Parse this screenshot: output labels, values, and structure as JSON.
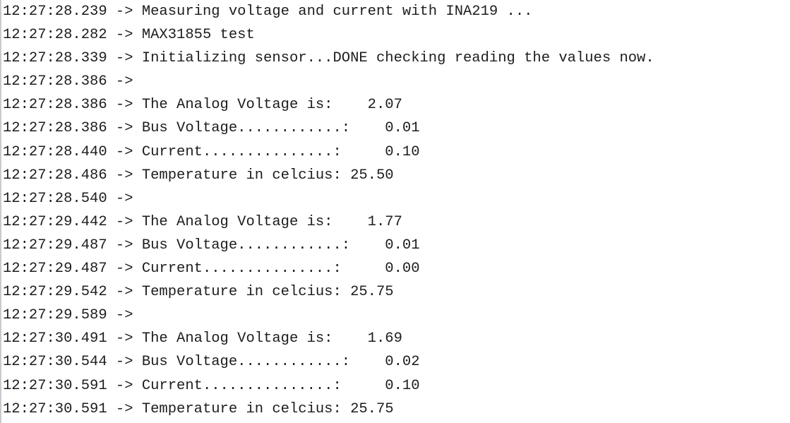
{
  "app": {
    "name": "serial-monitor",
    "background_color": "#ffffff",
    "text_color": "#1d1d1f",
    "border_color": "#c9c9cf"
  },
  "log": {
    "arrow": "->",
    "line_count": 18,
    "lines": [
      {
        "timestamp": "12:27:28.239",
        "arrow": "->",
        "message": "Measuring voltage and current with INA219 ...",
        "text": "12:27:28.239 -> Measuring voltage and current with INA219 ..."
      },
      {
        "timestamp": "12:27:28.282",
        "arrow": "->",
        "message": "MAX31855 test",
        "text": "12:27:28.282 -> MAX31855 test"
      },
      {
        "timestamp": "12:27:28.339",
        "arrow": "->",
        "message": "Initializing sensor...DONE checking reading the values now.",
        "text": "12:27:28.339 -> Initializing sensor...DONE checking reading the values now."
      },
      {
        "timestamp": "12:27:28.386",
        "arrow": "->",
        "message": "",
        "text": "12:27:28.386 ->"
      },
      {
        "timestamp": "12:27:28.386",
        "arrow": "->",
        "label": "The Analog Voltage is:",
        "value": "2.07",
        "text": "12:27:28.386 -> The Analog Voltage is:    2.07"
      },
      {
        "timestamp": "12:27:28.386",
        "arrow": "->",
        "label": "Bus Voltage............:",
        "value": "0.01",
        "text": "12:27:28.386 -> Bus Voltage............:    0.01"
      },
      {
        "timestamp": "12:27:28.440",
        "arrow": "->",
        "label": "Current...............:",
        "value": "0.10",
        "text": "12:27:28.440 -> Current...............:     0.10"
      },
      {
        "timestamp": "12:27:28.486",
        "arrow": "->",
        "label": "Temperature in celcius:",
        "value": "25.50",
        "text": "12:27:28.486 -> Temperature in celcius: 25.50"
      },
      {
        "timestamp": "12:27:28.540",
        "arrow": "->",
        "message": "",
        "text": "12:27:28.540 ->"
      },
      {
        "timestamp": "12:27:29.442",
        "arrow": "->",
        "label": "The Analog Voltage is:",
        "value": "1.77",
        "text": "12:27:29.442 -> The Analog Voltage is:    1.77"
      },
      {
        "timestamp": "12:27:29.487",
        "arrow": "->",
        "label": "Bus Voltage............:",
        "value": "0.01",
        "text": "12:27:29.487 -> Bus Voltage............:    0.01"
      },
      {
        "timestamp": "12:27:29.487",
        "arrow": "->",
        "label": "Current...............:",
        "value": "0.00",
        "text": "12:27:29.487 -> Current...............:     0.00"
      },
      {
        "timestamp": "12:27:29.542",
        "arrow": "->",
        "label": "Temperature in celcius:",
        "value": "25.75",
        "text": "12:27:29.542 -> Temperature in celcius: 25.75"
      },
      {
        "timestamp": "12:27:29.589",
        "arrow": "->",
        "message": "",
        "text": "12:27:29.589 ->"
      },
      {
        "timestamp": "12:27:30.491",
        "arrow": "->",
        "label": "The Analog Voltage is:",
        "value": "1.69",
        "text": "12:27:30.491 -> The Analog Voltage is:    1.69"
      },
      {
        "timestamp": "12:27:30.544",
        "arrow": "->",
        "label": "Bus Voltage............:",
        "value": "0.02",
        "text": "12:27:30.544 -> Bus Voltage............:    0.02"
      },
      {
        "timestamp": "12:27:30.591",
        "arrow": "->",
        "label": "Current...............:",
        "value": "0.10",
        "text": "12:27:30.591 -> Current...............:     0.10"
      },
      {
        "timestamp": "12:27:30.591",
        "arrow": "->",
        "label": "Temperature in celcius:",
        "value": "25.75",
        "text": "12:27:30.591 -> Temperature in celcius: 25.75"
      }
    ]
  }
}
